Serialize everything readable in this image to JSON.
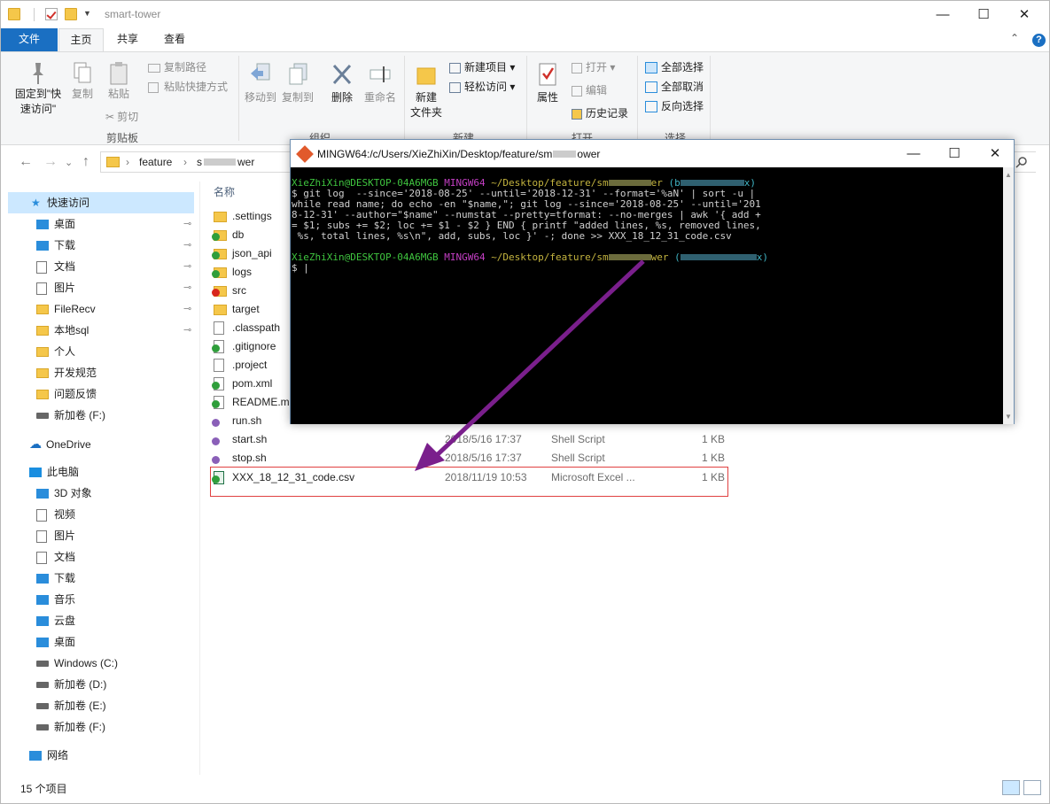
{
  "window": {
    "title": "smart-tower",
    "minimize_icon": "minimize-icon",
    "maximize_icon": "maximize-icon",
    "close_icon": "close-icon"
  },
  "ribbon_tabs": {
    "file": "文件",
    "home": "主页",
    "share": "共享",
    "view": "查看"
  },
  "ribbon": {
    "pin_label_1": "固定到\"快",
    "pin_label_2": "速访问\"",
    "copy": "复制",
    "paste": "粘贴",
    "copy_path": "复制路径",
    "paste_shortcut": "粘贴快捷方式",
    "cut": "剪切",
    "group_clipboard": "剪贴板",
    "move_to": "移动到",
    "copy_to": "复制到",
    "delete": "删除",
    "rename": "重命名",
    "group_organize": "组织",
    "new_folder_1": "新建",
    "new_folder_2": "文件夹",
    "new_item": "新建项目",
    "easy_access": "轻松访问",
    "group_new": "新建",
    "properties": "属性",
    "open": "打开",
    "edit": "编辑",
    "history": "历史记录",
    "group_open": "打开",
    "select_all": "全部选择",
    "select_none": "全部取消",
    "invert_selection": "反向选择",
    "group_select": "选择"
  },
  "address": {
    "crumb_1": "feature",
    "crumb_2": "s",
    "crumb_2_tail": "wer"
  },
  "nav": {
    "quick_access": "快速访问",
    "items_pinned": [
      "桌面",
      "下载",
      "文档",
      "图片",
      "FileRecv",
      "本地sql"
    ],
    "items_unpinned": [
      "个人",
      "开发规范",
      "问题反馈"
    ],
    "drive_f_quick": "新加卷 (F:)",
    "onedrive": "OneDrive",
    "this_pc": "此电脑",
    "pc_items": [
      "3D 对象",
      "视频",
      "图片",
      "文档",
      "下载",
      "音乐",
      "云盘",
      "桌面"
    ],
    "drives": [
      "Windows (C:)",
      "新加卷 (D:)",
      "新加卷 (E:)",
      "新加卷 (F:)"
    ],
    "network": "网络"
  },
  "list": {
    "col_name": "名称",
    "files": [
      {
        "name": ".settings",
        "icon": "folder-icon",
        "date": "",
        "type": "",
        "size": ""
      },
      {
        "name": "db",
        "icon": "folder-icon",
        "date": "",
        "type": "",
        "size": ""
      },
      {
        "name": "json_api",
        "icon": "folder-icon",
        "date": "",
        "type": "",
        "size": ""
      },
      {
        "name": "logs",
        "icon": "folder-icon",
        "date": "",
        "type": "",
        "size": ""
      },
      {
        "name": "src",
        "icon": "folder-icon",
        "date": "",
        "type": "",
        "size": ""
      },
      {
        "name": "target",
        "icon": "folder-icon",
        "date": "",
        "type": "",
        "size": ""
      },
      {
        "name": ".classpath",
        "icon": "file-icon",
        "date": "",
        "type": "",
        "size": ""
      },
      {
        "name": ".gitignore",
        "icon": "file-icon",
        "date": "",
        "type": "",
        "size": ""
      },
      {
        "name": ".project",
        "icon": "file-icon",
        "date": "",
        "type": "",
        "size": ""
      },
      {
        "name": "pom.xml",
        "icon": "file-icon",
        "date": "",
        "type": "",
        "size": ""
      },
      {
        "name": "README.m",
        "icon": "file-icon",
        "date": "",
        "type": "",
        "size": ""
      },
      {
        "name": "run.sh",
        "icon": "script-icon",
        "date": "",
        "type": "",
        "size": ""
      },
      {
        "name": "start.sh",
        "icon": "script-icon",
        "date": "2018/5/16 17:37",
        "type": "Shell Script",
        "size": "1 KB"
      },
      {
        "name": "stop.sh",
        "icon": "script-icon",
        "date": "2018/5/16 17:37",
        "type": "Shell Script",
        "size": "1 KB"
      },
      {
        "name": "XXX_18_12_31_code.csv",
        "icon": "excel-icon",
        "date": "2018/11/19 10:53",
        "type": "Microsoft Excel ...",
        "size": "1 KB"
      }
    ]
  },
  "status": {
    "count": "15 个项目"
  },
  "terminal": {
    "title": "MINGW64:/c/Users/XieZhiXin/Desktop/feature/sm",
    "title_tail": "ower",
    "prompt_user": "XieZhiXin@DESKTOP-04A6MGB",
    "prompt_env": "MINGW64",
    "prompt_path_1": "~/Desktop/feature/sm",
    "prompt_path_1_tail": "er",
    "prompt_branch_1": "(b",
    "prompt_branch_1_tail": "x)",
    "cmd_lines": [
      "$ git log  --since='2018-08-25' --until='2018-12-31' --format='%aN' | sort -u |",
      "while read name; do echo -en \"$name,\"; git log --since='2018-08-25' --until='201",
      "8-12-31' --author=\"$name\" --numstat --pretty=tformat: --no-merges | awk '{ add +",
      "= $1; subs += $2; loc += $1 - $2 } END { printf \"added lines, %s, removed lines,",
      " %s, total lines, %s\\n\", add, subs, loc }' -; done >> XXX_18_12_31_code.csv"
    ],
    "prompt_path_2": "~/Desktop/feature/sm",
    "prompt_path_2_tail": "wer",
    "prompt_branch_2": "(",
    "prompt_branch_2_tail": "x)",
    "cursor_line": "$ |"
  },
  "colors": {
    "accent": "#1a6fc2",
    "highlight_box": "#e04040",
    "arrow": "#7a1f8c"
  }
}
